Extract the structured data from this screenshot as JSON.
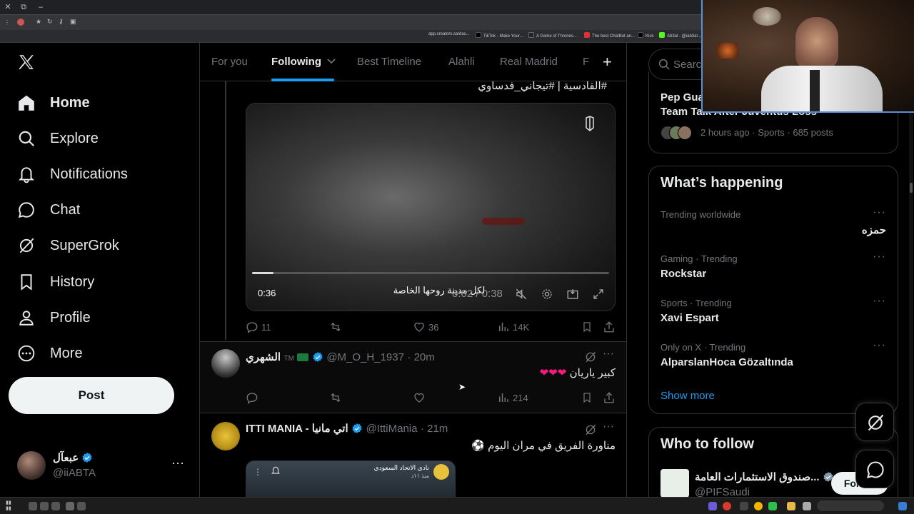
{
  "browser": {
    "bookmarks": [
      "app.creators.sa/das...",
      "TikTok - Make Your...",
      "A Game of Thrones...",
      "The best ChatBot an...",
      "Kick",
      "Ab3al - @iab3al..."
    ]
  },
  "nav": {
    "logo": "X",
    "items": [
      {
        "label": "Home",
        "icon": "home-icon"
      },
      {
        "label": "Explore",
        "icon": "search-icon"
      },
      {
        "label": "Notifications",
        "icon": "bell-icon"
      },
      {
        "label": "Chat",
        "icon": "chat-icon"
      },
      {
        "label": "SuperGrok",
        "icon": "grok-icon"
      },
      {
        "label": "History",
        "icon": "bookmark-icon"
      },
      {
        "label": "Profile",
        "icon": "person-icon"
      },
      {
        "label": "More",
        "icon": "more-circle-icon"
      }
    ],
    "post_label": "Post",
    "account": {
      "name": "عبعآل",
      "handle": "@iiABTA"
    }
  },
  "tabs": [
    "For you",
    "Following",
    "Best Timeline",
    "Alahli",
    "Real Madrid",
    "F"
  ],
  "tweet1": {
    "hashtags": "#القادسية | #تيجاني_فدساوي",
    "video": {
      "duration_badge": "0:36",
      "caption": "لكل مدينة روحها الخاصة",
      "time": "0:02 / 0:38",
      "progress": 0.06
    },
    "stats": {
      "replies": "11",
      "retweets": "",
      "likes": "36",
      "views": "14K"
    }
  },
  "tweet2": {
    "name": "الشهري",
    "badge": "TM",
    "handle": "@M_O_H_1937",
    "time": "· 20m",
    "text": "كبير ياريان",
    "stats": {
      "replies": "",
      "retweets": "",
      "likes": "",
      "views": "214"
    }
  },
  "tweet3": {
    "name": "ITTI MANIA - اتي مانيا",
    "handle": "@IttiMania",
    "time": "· 21m",
    "text": "مناورة الفريق في مران اليوم ⚽",
    "embed_title": "نادي الاتحاد السعودي",
    "embed_sub": "منذ ١١د"
  },
  "right": {
    "search_placeholder": "Search",
    "news": {
      "title_line1": "Pep Guardiola",
      "title_line2": "Team Talk After Juventus Loss",
      "meta": "2 hours ago · Sports · 685 posts"
    },
    "whats_happening": {
      "heading": "What’s happening",
      "trends": [
        {
          "meta": "Trending worldwide",
          "name": "حمزه"
        },
        {
          "meta": "Gaming · Trending",
          "name": "Rockstar"
        },
        {
          "meta": "Sports · Trending",
          "name": "Xavi Espart"
        },
        {
          "meta": "Only on X · Trending",
          "name": "AlparslanHoca Gözaltında"
        }
      ],
      "show_more": "Show more"
    },
    "who_to_follow": {
      "heading": "Who to follow",
      "name": "صندوق الاستثمارات العامة...",
      "handle": "@PIFSaudi",
      "follow_label": "Follow"
    }
  },
  "colors": {
    "accent": "#1d9bf0",
    "background": "#000000",
    "border": "#2f3336",
    "muted": "#71767b",
    "heart": "#f91880"
  }
}
